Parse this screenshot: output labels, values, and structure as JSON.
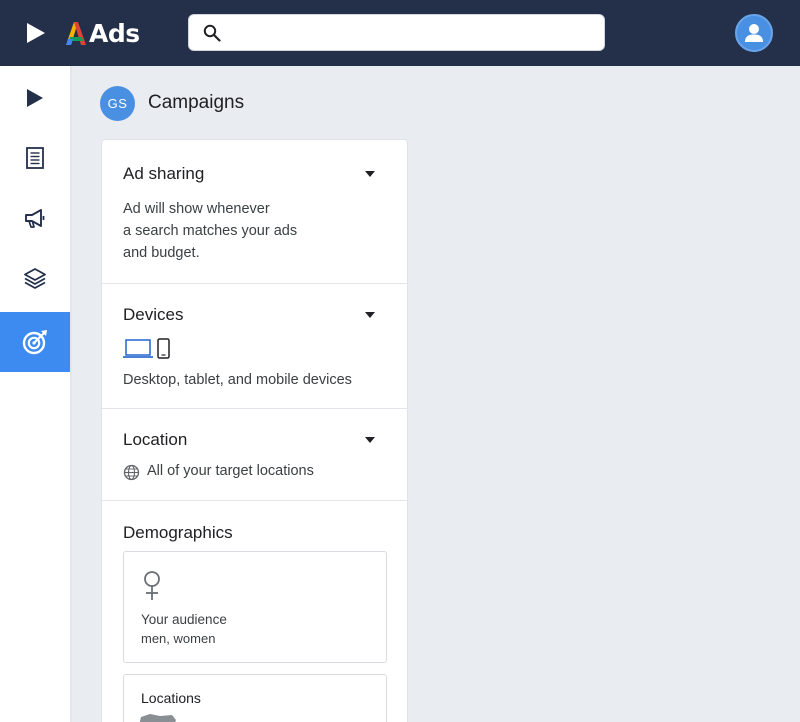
{
  "app": {
    "logo_text": "Ads"
  },
  "search": {
    "value": "",
    "placeholder": ""
  },
  "header": {
    "avatar_initials": "GS",
    "title": "Campaigns"
  },
  "rail": {
    "items": [
      {
        "icon": "play-icon"
      },
      {
        "icon": "document-icon"
      },
      {
        "icon": "megaphone-icon"
      },
      {
        "icon": "layers-icon"
      },
      {
        "icon": "target-icon",
        "active": true
      }
    ]
  },
  "sections": {
    "ad_sharing": {
      "title": "Ad sharing",
      "lines": [
        "Ad will show whenever",
        "a search matches your ads",
        "and budget."
      ]
    },
    "devices": {
      "title": "Devices",
      "text": "Desktop, tablet, and mobile devices"
    },
    "location": {
      "title": "Location",
      "text": "All of your target locations"
    },
    "demographics": {
      "title": "Demographics",
      "audience_label": "Your audience",
      "audience_value": "men, women",
      "locations_label": "Locations"
    }
  },
  "colors": {
    "topbar": "#24304a",
    "accent": "#3d8bf0",
    "avatar": "#4a90e2"
  }
}
